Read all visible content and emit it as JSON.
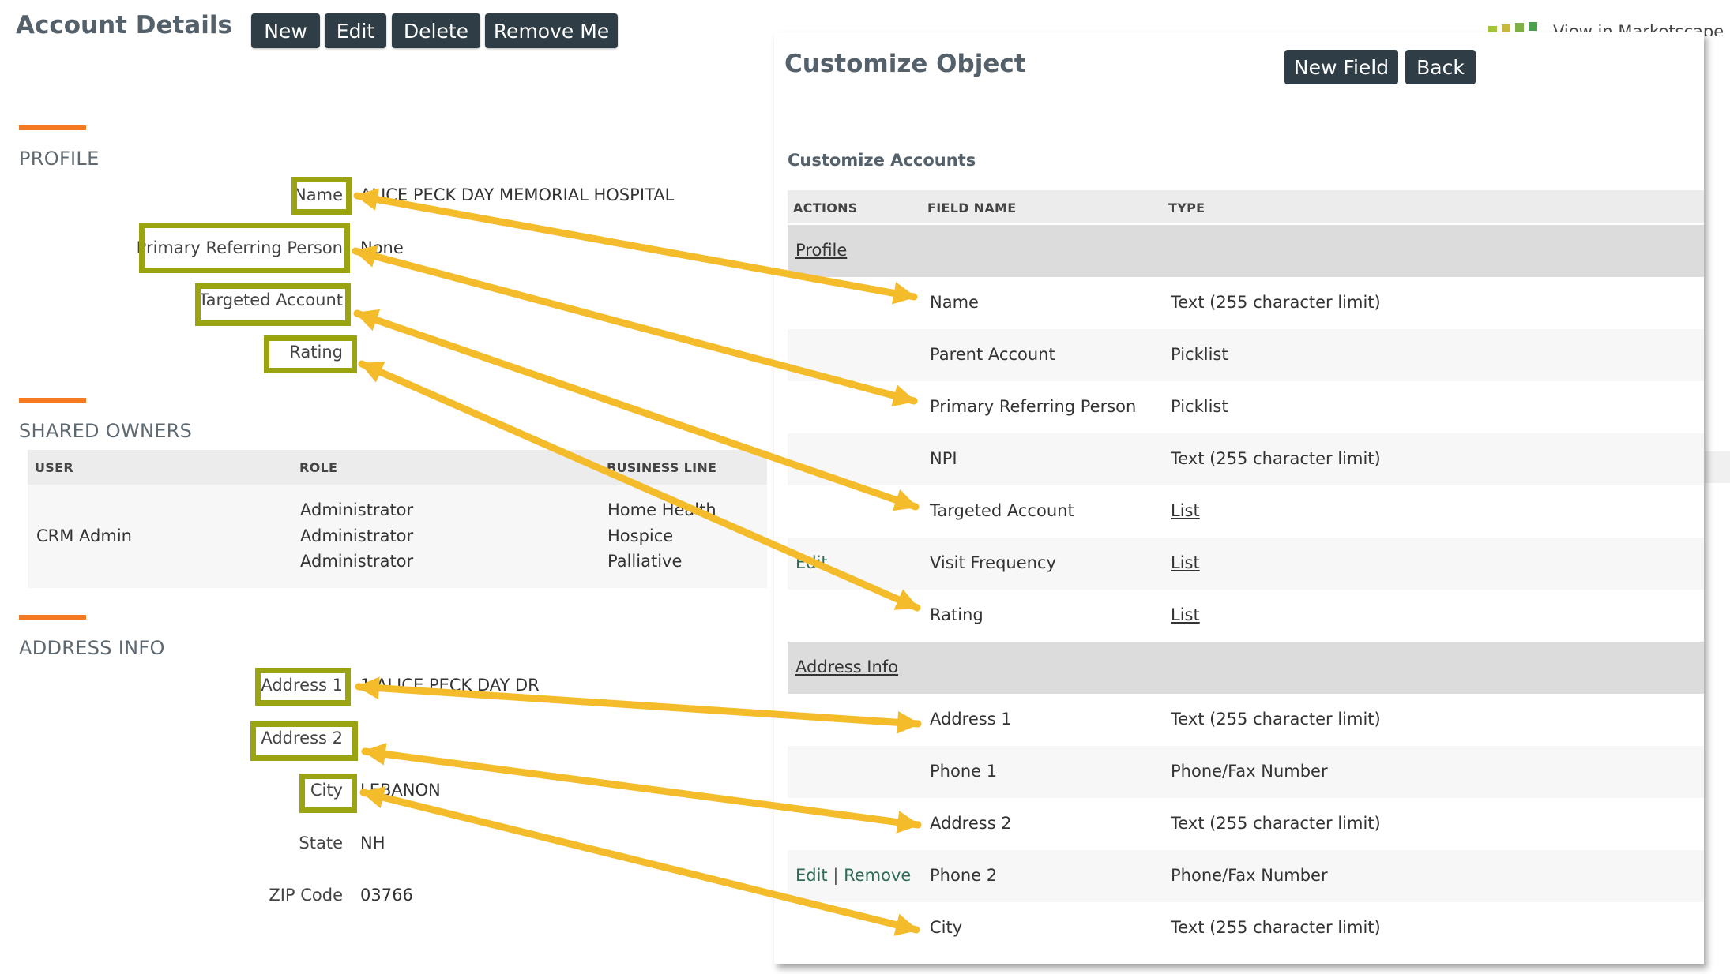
{
  "header": {
    "title": "Account Details",
    "buttons": [
      "New",
      "Edit",
      "Delete",
      "Remove Me"
    ],
    "marketscape": "View in Marketscape"
  },
  "profile": {
    "title": "PROFILE",
    "fields": [
      {
        "label": "Name",
        "value": "ALICE PECK DAY MEMORIAL HOSPITAL"
      },
      {
        "label": "Primary Referring Person",
        "value": "None"
      },
      {
        "label": "Targeted Account",
        "value": ""
      },
      {
        "label": "Rating",
        "value": ""
      }
    ]
  },
  "shared_owners": {
    "title": "SHARED OWNERS",
    "columns": [
      "USER",
      "ROLE",
      "BUSINESS LINE"
    ],
    "user": "CRM Admin",
    "roles": [
      "Administrator",
      "Administrator",
      "Administrator"
    ],
    "lines": [
      "Home Health",
      "Hospice",
      "Palliative"
    ]
  },
  "address_info": {
    "title": "ADDRESS INFO",
    "fields": [
      {
        "label": "Address 1",
        "value": "1 ALICE PECK DAY DR"
      },
      {
        "label": "Address 2",
        "value": ""
      },
      {
        "label": "City",
        "value": "LEBANON"
      },
      {
        "label": "State",
        "value": "NH"
      },
      {
        "label": "ZIP Code",
        "value": "03766"
      }
    ]
  },
  "customize": {
    "title": "Customize Object",
    "buttons": [
      "New Field",
      "Back"
    ],
    "subtitle": "Customize Accounts",
    "columns": [
      "ACTIONS",
      "FIELD NAME",
      "TYPE"
    ],
    "rows": [
      {
        "group": "Profile"
      },
      {
        "actions": "",
        "field": "Name",
        "type": "Text (255 character limit)"
      },
      {
        "actions": "",
        "field": "Parent Account",
        "type": "Picklist"
      },
      {
        "actions": "",
        "field": "Primary Referring Person",
        "type": "Picklist"
      },
      {
        "actions": "",
        "field": "NPI",
        "type": "Text (255 character limit)"
      },
      {
        "actions": "",
        "field": "Targeted Account",
        "type": "List"
      },
      {
        "actions": "",
        "field": "Visit Frequency",
        "type": "List"
      },
      {
        "actions": "",
        "field": "Rating",
        "type": "List"
      },
      {
        "group": "Address Info"
      },
      {
        "actions": "",
        "field": "Address 1",
        "type": "Text (255 character limit)"
      },
      {
        "actions": "",
        "field": "Phone 1",
        "type": "Phone/Fax Number"
      },
      {
        "actions": "",
        "field": "Address 2",
        "type": "Text (255 character limit)"
      },
      {
        "actions": "Edit | Remove",
        "field": "Phone 2",
        "type": "Phone/Fax Number"
      },
      {
        "actions": "",
        "field": "City",
        "type": "Text (255 character limit)"
      }
    ],
    "edit_link": "Edit",
    "remove_link": "Remove"
  },
  "colors": {
    "accent": "#f47920",
    "highlight": "#9aa411",
    "arrow": "#f4bc2b",
    "button": "#2f3d46"
  }
}
